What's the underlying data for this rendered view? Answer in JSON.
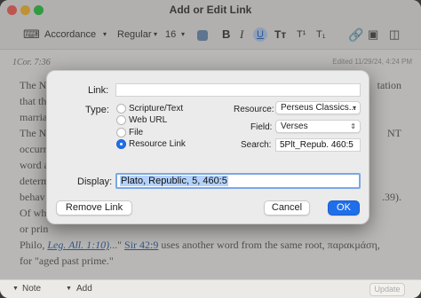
{
  "window": {
    "title": "Add or Edit Link"
  },
  "toolbar": {
    "style_name": "Accordance",
    "weight": "Regular",
    "size": "16",
    "bold": "B",
    "italic": "I",
    "underline": "U",
    "tt": "Tт",
    "superscript": "T¹",
    "subscript": "T₁"
  },
  "editor": {
    "reference": "1Cor. 7:36",
    "edited": "Edited 11/29/24, 4:24 PM",
    "lines": [
      "The N",
      "that th",
      "marria",
      "The N",
      "occurr",
      "word a",
      "determ",
      "behav",
      "Of wh",
      "or prin"
    ],
    "right_lines": [
      "tation",
      "NT",
      ".39)."
    ],
    "bottom_line_1_pre": "Philo, ",
    "bottom_link_1": "Leg. All. 1:10)",
    "bottom_line_1_mid": "...\"  ",
    "bottom_link_2": "Sir 42:9",
    "bottom_line_1_post": " uses another word from the same root, παρακμάση,",
    "bottom_line_2": "for \"aged past prime.\""
  },
  "bottombar": {
    "note": "Note",
    "add": "Add",
    "update": "Update"
  },
  "dialog": {
    "link_label": "Link:",
    "link_value": "",
    "type_label": "Type:",
    "types": [
      {
        "label": "Scripture/Text",
        "selected": false
      },
      {
        "label": "Web URL",
        "selected": false
      },
      {
        "label": "File",
        "selected": false
      },
      {
        "label": "Resource Link",
        "selected": true
      }
    ],
    "resource_label": "Resource:",
    "resource_value": "Perseus Classics...",
    "field_label": "Field:",
    "field_value": "Verses",
    "search_label": "Search:",
    "search_value": "5Plt_Repub. 460:5",
    "display_label": "Display:",
    "display_value": "Plato, Republic, 5, 460:5",
    "remove_button": "Remove Link",
    "cancel_button": "Cancel",
    "ok_button": "OK"
  },
  "colors": {
    "accent": "#1f6feb",
    "link": "#2a5db0"
  }
}
